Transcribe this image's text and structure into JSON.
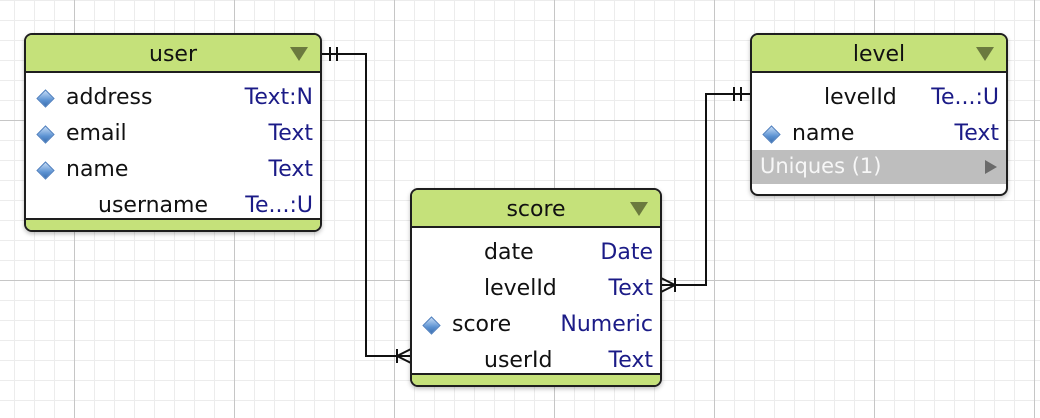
{
  "entities": {
    "user": {
      "title": "user",
      "attributes": [
        {
          "name": "address",
          "type": "Text:N",
          "indexed": true
        },
        {
          "name": "email",
          "type": "Text",
          "indexed": true
        },
        {
          "name": "name",
          "type": "Text",
          "indexed": true
        },
        {
          "name": "username",
          "type": "Te...:U",
          "indexed": false
        }
      ]
    },
    "score": {
      "title": "score",
      "attributes": [
        {
          "name": "date",
          "type": "Date",
          "indexed": false
        },
        {
          "name": "levelId",
          "type": "Text",
          "indexed": false
        },
        {
          "name": "score",
          "type": "Numeric",
          "indexed": true
        },
        {
          "name": "userId",
          "type": "Text",
          "indexed": false
        }
      ]
    },
    "level": {
      "title": "level",
      "attributes": [
        {
          "name": "levelId",
          "type": "Te...:U",
          "indexed": false
        },
        {
          "name": "name",
          "type": "Text",
          "indexed": true
        }
      ],
      "uniques_label": "Uniques (1)"
    }
  },
  "relationships": [
    {
      "from": "user",
      "to": "score",
      "from_cardinality": "one-and-only-one",
      "to_cardinality": "many"
    },
    {
      "from": "level",
      "to": "score",
      "from_cardinality": "one-and-only-one",
      "to_cardinality": "many"
    }
  ],
  "colors": {
    "header": "#c5e17a",
    "menu_arrow": "#6b7a3e",
    "type_text": "#1b1b87",
    "index_diamond": "#5d93d3",
    "uniques_bg": "#bebebe",
    "border": "#1e1e1e"
  }
}
